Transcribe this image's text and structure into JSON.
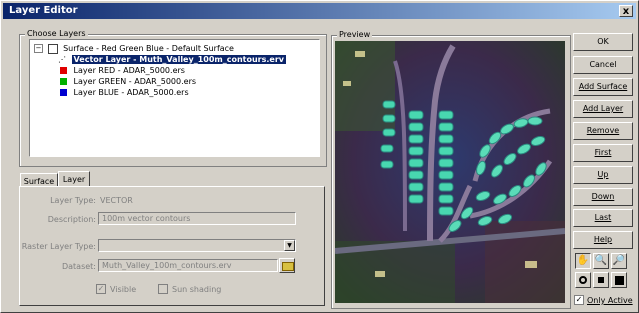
{
  "window": {
    "title": "Layer Editor",
    "close_glyph": "x"
  },
  "choose_layers": {
    "group_label": "Choose Layers",
    "surface_label": "Surface - Red Green Blue - Default Surface",
    "layers": [
      {
        "label": "Vector Layer - Muth_Valley_100m_contours.erv",
        "selected": true,
        "swatch": "vector-icon"
      },
      {
        "label": "Layer RED - ADAR_5000.ers",
        "color": "#e00000"
      },
      {
        "label": "Layer GREEN - ADAR_5000.ers",
        "color": "#00b000"
      },
      {
        "label": "Layer BLUE - ADAR_5000.ers",
        "color": "#0000d0"
      }
    ]
  },
  "tabs": [
    {
      "label": "Surface"
    },
    {
      "label": "Layer"
    }
  ],
  "layer_tab": {
    "layer_type_label": "Layer Type:",
    "layer_type_value": "VECTOR",
    "description_label": "Description:",
    "description_value": "100m vector contours",
    "raster_layer_type_label": "Raster Layer Type:",
    "raster_layer_type_value": "",
    "dataset_label": "Dataset:",
    "dataset_value": "Muth_Valley_100m_contours.erv",
    "checkbox1_label": "Visible",
    "checkbox2_label": "Sun shading"
  },
  "preview": {
    "group_label": "Preview"
  },
  "buttons": {
    "ok": "OK",
    "cancel": "Cancel",
    "add_surface": "Add Surface",
    "add_layer": "Add Layer",
    "remove": "Remove",
    "first": "First",
    "up": "Up",
    "down": "Down",
    "last": "Last",
    "help": "Help"
  },
  "tools": {
    "hand": "hand-icon",
    "zoom_in": "zoom-in-icon",
    "zoom_out": "zoom-out-icon",
    "t1": "record-icon",
    "t2": "stop-icon",
    "t3": "close-box-icon"
  },
  "only_active_label": "Only Active"
}
